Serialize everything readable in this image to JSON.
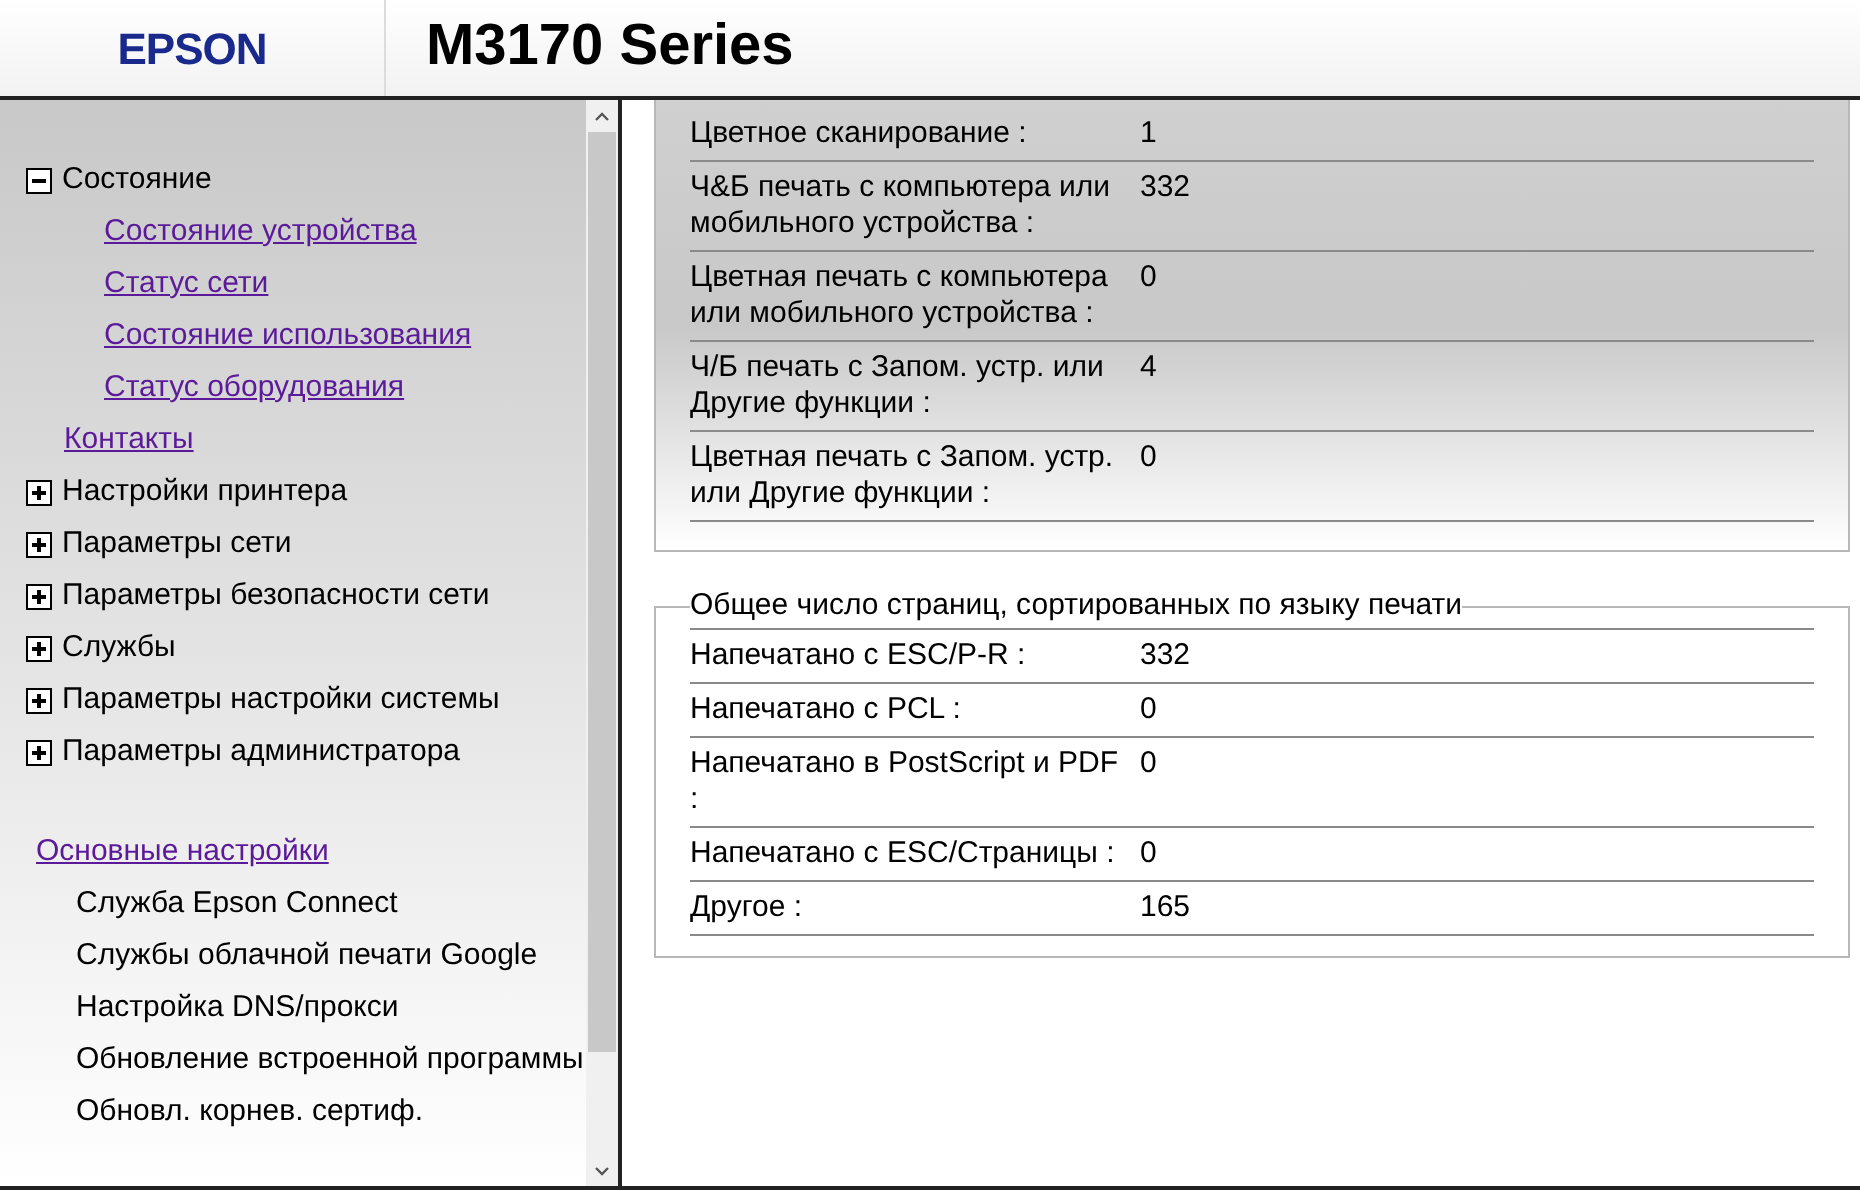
{
  "header": {
    "logo": "EPSON",
    "title": "M3170 Series"
  },
  "sidebar": {
    "items": [
      {
        "label": "Состояние",
        "kind": "group",
        "expanded": true,
        "children": [
          {
            "label": "Состояние устройства",
            "kind": "link"
          },
          {
            "label": "Статус сети",
            "kind": "link"
          },
          {
            "label": "Состояние использования",
            "kind": "link"
          },
          {
            "label": "Статус оборудования",
            "kind": "link"
          }
        ]
      },
      {
        "label": "Контакты",
        "kind": "link"
      },
      {
        "label": "Настройки принтера",
        "kind": "group",
        "expanded": false
      },
      {
        "label": "Параметры сети",
        "kind": "group",
        "expanded": false
      },
      {
        "label": "Параметры безопасности сети",
        "kind": "group",
        "expanded": false
      },
      {
        "label": "Службы",
        "kind": "group",
        "expanded": false
      },
      {
        "label": "Параметры настройки системы",
        "kind": "group",
        "expanded": false
      },
      {
        "label": "Параметры администратора",
        "kind": "group",
        "expanded": false
      }
    ],
    "basic_settings": {
      "title": "Основные настройки",
      "items": [
        "Служба Epson Connect",
        "Службы облачной печати Google",
        "Настройка DNS/прокси",
        "Обновление встроенной программы",
        "Обновл. корнев. сертиф."
      ]
    }
  },
  "sections": [
    {
      "rows": [
        {
          "label": "Цветное сканирование :",
          "value": "1"
        },
        {
          "label": "Ч&Б печать с компьютера или мобильного устройства :",
          "value": "332"
        },
        {
          "label": "Цветная печать с компьютера или мобильного устройства :",
          "value": "0"
        },
        {
          "label": "Ч/Б печать с Запом. устр. или Другие функции :",
          "value": "4"
        },
        {
          "label": "Цветная печать с Запом. устр. или Другие функции :",
          "value": "0"
        }
      ]
    },
    {
      "legend": "Общее число страниц, сортированных по языку печати",
      "rows": [
        {
          "label": "Напечатано с ESC/P-R :",
          "value": "332"
        },
        {
          "label": "Напечатано с PCL :",
          "value": "0"
        },
        {
          "label": "Напечатано в PostScript и PDF :",
          "value": "0"
        },
        {
          "label": "Напечатано с ESC/Страницы :",
          "value": "0"
        },
        {
          "label": "Другое :",
          "value": "165"
        }
      ]
    }
  ]
}
